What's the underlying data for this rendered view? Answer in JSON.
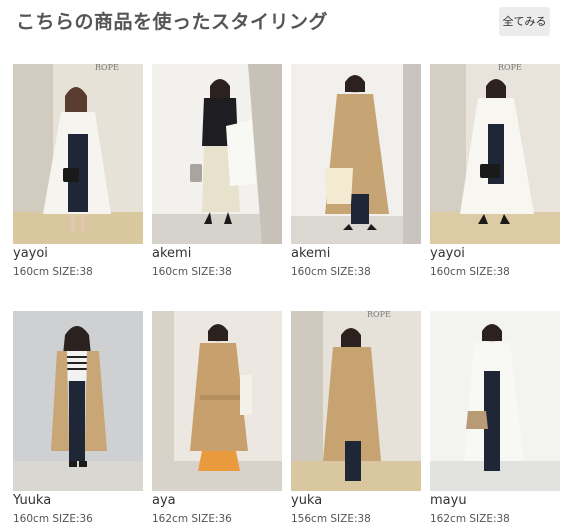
{
  "header": {
    "title": "こちらの商品を使ったスタイリング",
    "see_all_label": "全てみる"
  },
  "stylings": [
    {
      "name": "yayoi",
      "meta": "160cm SIZE:38",
      "coat": "white",
      "bag": "black"
    },
    {
      "name": "akemi",
      "meta": "160cm SIZE:38",
      "coat": "white-carried",
      "bag": "gray"
    },
    {
      "name": "akemi",
      "meta": "160cm SIZE:38",
      "coat": "beige",
      "bag": "cream"
    },
    {
      "name": "yayoi",
      "meta": "160cm SIZE:38",
      "coat": "white",
      "bag": "black"
    },
    {
      "name": "Yuuka",
      "meta": "160cm SIZE:36",
      "coat": "beige",
      "bag": "none"
    },
    {
      "name": "aya",
      "meta": "162cm SIZE:36",
      "coat": "beige",
      "bag": "none"
    },
    {
      "name": "yuka",
      "meta": "156cm SIZE:38",
      "coat": "beige",
      "bag": "none"
    },
    {
      "name": "mayu",
      "meta": "162cm SIZE:38",
      "coat": "white",
      "bag": "tan"
    }
  ]
}
